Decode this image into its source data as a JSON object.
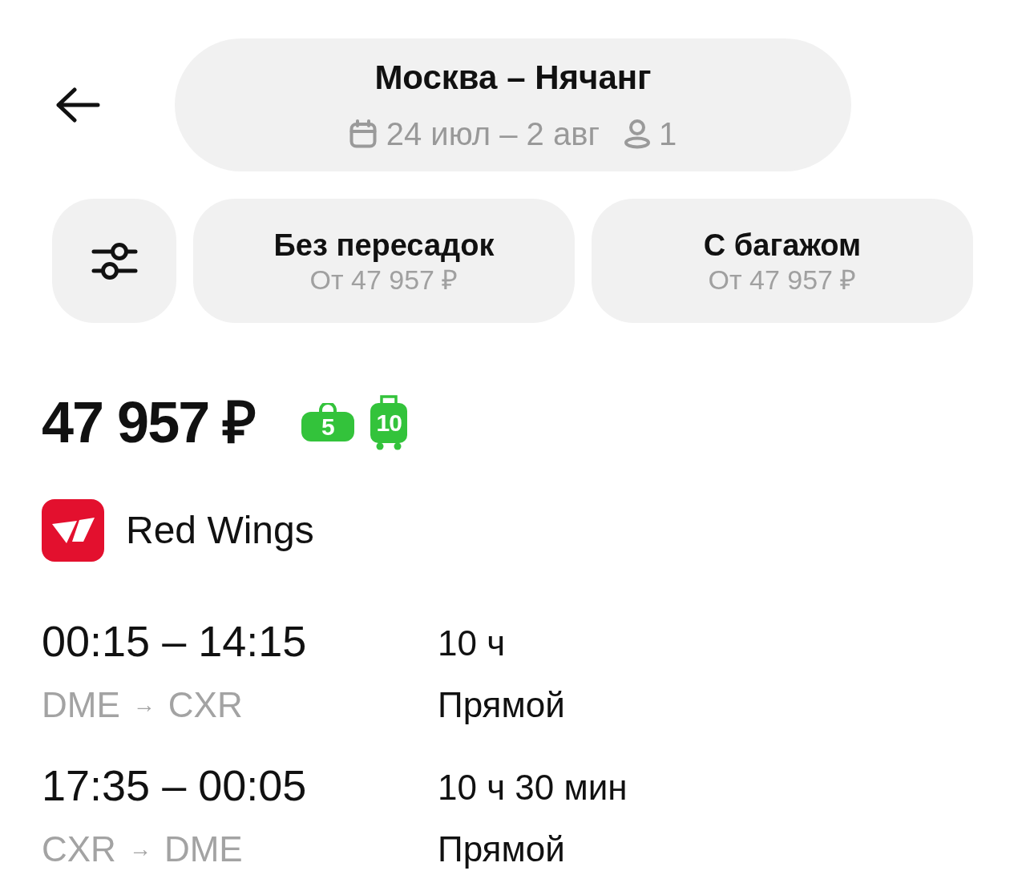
{
  "header": {
    "title": "Москва – Нячанг",
    "dates": "24 июл – 2 авг",
    "passengers": "1"
  },
  "filters": [
    {
      "label": "Без пересадок",
      "price": "От 47 957 ₽"
    },
    {
      "label": "С багажом",
      "price": "От 47 957 ₽"
    }
  ],
  "offer": {
    "price": "47 957 ₽",
    "baggage": [
      {
        "kind": "hand",
        "weight": "5"
      },
      {
        "kind": "checked",
        "weight": "10"
      }
    ],
    "airline": "Red Wings",
    "flights": [
      {
        "times": "00:15 – 14:15",
        "origin": "DME",
        "arrow": "→",
        "destination": "CXR",
        "duration": "10 ч",
        "stops": "Прямой"
      },
      {
        "times": "17:35 – 00:05",
        "origin": "CXR",
        "arrow": "→",
        "destination": "DME",
        "duration": "10 ч 30 мин",
        "stops": "Прямой"
      }
    ]
  }
}
